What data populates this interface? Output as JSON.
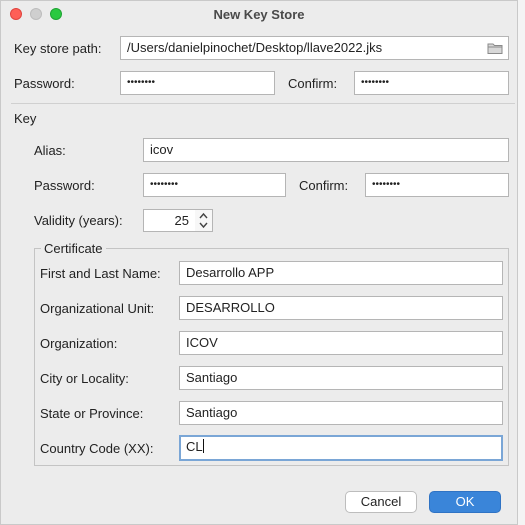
{
  "window": {
    "title": "New Key Store"
  },
  "keystore": {
    "path_label": "Key store path:",
    "path_value": "/Users/danielpinochet/Desktop/llave2022.jks",
    "password_label": "Password:",
    "password_value": "••••••••",
    "confirm_label": "Confirm:",
    "confirm_value": "••••••••"
  },
  "key": {
    "section_label": "Key",
    "alias_label": "Alias:",
    "alias_value": "icov",
    "password_label": "Password:",
    "password_value": "••••••••",
    "confirm_label": "Confirm:",
    "confirm_value": "••••••••",
    "validity_label": "Validity (years):",
    "validity_value": "25"
  },
  "certificate": {
    "group_label": "Certificate",
    "fields": [
      {
        "label": "First and Last Name:",
        "value": "Desarrollo APP"
      },
      {
        "label": "Organizational Unit:",
        "value": "DESARROLLO"
      },
      {
        "label": "Organization:",
        "value": "ICOV"
      },
      {
        "label": "City or Locality:",
        "value": "Santiago"
      },
      {
        "label": "State or Province:",
        "value": "Santiago"
      },
      {
        "label": "Country Code (XX):",
        "value": "CL"
      }
    ]
  },
  "buttons": {
    "cancel": "Cancel",
    "ok": "OK"
  },
  "icons": {
    "browse": "folder-icon",
    "spinner": "stepper-arrows-icon"
  },
  "colors": {
    "accent": "#3a85d9",
    "focus_ring": "#7aa6d6"
  }
}
